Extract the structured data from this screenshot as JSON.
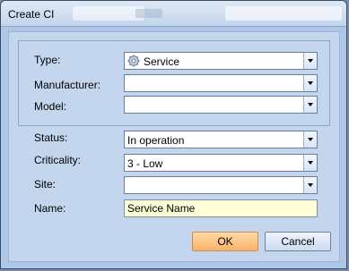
{
  "window": {
    "title": "Create CI"
  },
  "form": {
    "type": {
      "label": "Type:",
      "value": "Service",
      "icon": "gear-icon"
    },
    "manufacturer": {
      "label": "Manufacturer:",
      "value": ""
    },
    "model": {
      "label": "Model:",
      "value": ""
    },
    "status": {
      "label": "Status:",
      "value": "In operation"
    },
    "criticality": {
      "label": "Criticality:",
      "value": "3 - Low"
    },
    "site": {
      "label": "Site:",
      "value": ""
    },
    "name": {
      "label": "Name:",
      "value": "Service Name"
    }
  },
  "buttons": {
    "ok": "OK",
    "cancel": "Cancel"
  },
  "colors": {
    "ok_button": "#f9b36a",
    "name_field_bg": "#ffffd7",
    "dialog_bg": "#c4d6ee"
  }
}
